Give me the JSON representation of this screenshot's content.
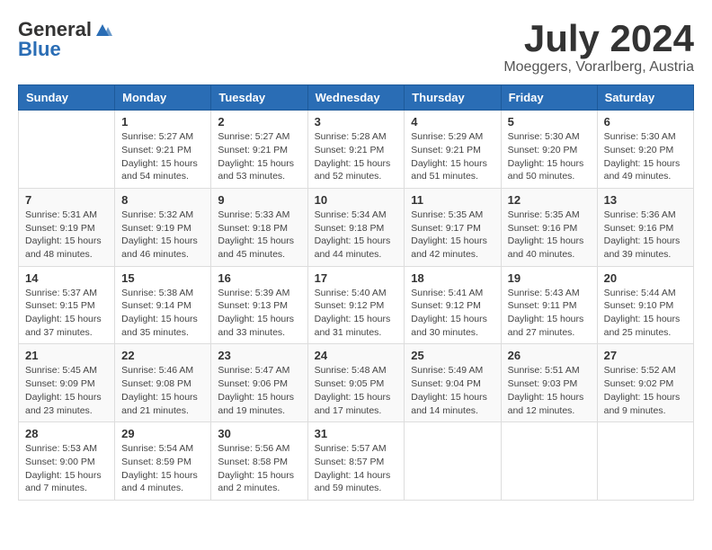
{
  "header": {
    "logo_general": "General",
    "logo_blue": "Blue",
    "month_year": "July 2024",
    "location": "Moeggers, Vorarlberg, Austria"
  },
  "weekdays": [
    "Sunday",
    "Monday",
    "Tuesday",
    "Wednesday",
    "Thursday",
    "Friday",
    "Saturday"
  ],
  "weeks": [
    [
      {
        "day": "",
        "info": ""
      },
      {
        "day": "1",
        "info": "Sunrise: 5:27 AM\nSunset: 9:21 PM\nDaylight: 15 hours\nand 54 minutes."
      },
      {
        "day": "2",
        "info": "Sunrise: 5:27 AM\nSunset: 9:21 PM\nDaylight: 15 hours\nand 53 minutes."
      },
      {
        "day": "3",
        "info": "Sunrise: 5:28 AM\nSunset: 9:21 PM\nDaylight: 15 hours\nand 52 minutes."
      },
      {
        "day": "4",
        "info": "Sunrise: 5:29 AM\nSunset: 9:21 PM\nDaylight: 15 hours\nand 51 minutes."
      },
      {
        "day": "5",
        "info": "Sunrise: 5:30 AM\nSunset: 9:20 PM\nDaylight: 15 hours\nand 50 minutes."
      },
      {
        "day": "6",
        "info": "Sunrise: 5:30 AM\nSunset: 9:20 PM\nDaylight: 15 hours\nand 49 minutes."
      }
    ],
    [
      {
        "day": "7",
        "info": "Sunrise: 5:31 AM\nSunset: 9:19 PM\nDaylight: 15 hours\nand 48 minutes."
      },
      {
        "day": "8",
        "info": "Sunrise: 5:32 AM\nSunset: 9:19 PM\nDaylight: 15 hours\nand 46 minutes."
      },
      {
        "day": "9",
        "info": "Sunrise: 5:33 AM\nSunset: 9:18 PM\nDaylight: 15 hours\nand 45 minutes."
      },
      {
        "day": "10",
        "info": "Sunrise: 5:34 AM\nSunset: 9:18 PM\nDaylight: 15 hours\nand 44 minutes."
      },
      {
        "day": "11",
        "info": "Sunrise: 5:35 AM\nSunset: 9:17 PM\nDaylight: 15 hours\nand 42 minutes."
      },
      {
        "day": "12",
        "info": "Sunrise: 5:35 AM\nSunset: 9:16 PM\nDaylight: 15 hours\nand 40 minutes."
      },
      {
        "day": "13",
        "info": "Sunrise: 5:36 AM\nSunset: 9:16 PM\nDaylight: 15 hours\nand 39 minutes."
      }
    ],
    [
      {
        "day": "14",
        "info": "Sunrise: 5:37 AM\nSunset: 9:15 PM\nDaylight: 15 hours\nand 37 minutes."
      },
      {
        "day": "15",
        "info": "Sunrise: 5:38 AM\nSunset: 9:14 PM\nDaylight: 15 hours\nand 35 minutes."
      },
      {
        "day": "16",
        "info": "Sunrise: 5:39 AM\nSunset: 9:13 PM\nDaylight: 15 hours\nand 33 minutes."
      },
      {
        "day": "17",
        "info": "Sunrise: 5:40 AM\nSunset: 9:12 PM\nDaylight: 15 hours\nand 31 minutes."
      },
      {
        "day": "18",
        "info": "Sunrise: 5:41 AM\nSunset: 9:12 PM\nDaylight: 15 hours\nand 30 minutes."
      },
      {
        "day": "19",
        "info": "Sunrise: 5:43 AM\nSunset: 9:11 PM\nDaylight: 15 hours\nand 27 minutes."
      },
      {
        "day": "20",
        "info": "Sunrise: 5:44 AM\nSunset: 9:10 PM\nDaylight: 15 hours\nand 25 minutes."
      }
    ],
    [
      {
        "day": "21",
        "info": "Sunrise: 5:45 AM\nSunset: 9:09 PM\nDaylight: 15 hours\nand 23 minutes."
      },
      {
        "day": "22",
        "info": "Sunrise: 5:46 AM\nSunset: 9:08 PM\nDaylight: 15 hours\nand 21 minutes."
      },
      {
        "day": "23",
        "info": "Sunrise: 5:47 AM\nSunset: 9:06 PM\nDaylight: 15 hours\nand 19 minutes."
      },
      {
        "day": "24",
        "info": "Sunrise: 5:48 AM\nSunset: 9:05 PM\nDaylight: 15 hours\nand 17 minutes."
      },
      {
        "day": "25",
        "info": "Sunrise: 5:49 AM\nSunset: 9:04 PM\nDaylight: 15 hours\nand 14 minutes."
      },
      {
        "day": "26",
        "info": "Sunrise: 5:51 AM\nSunset: 9:03 PM\nDaylight: 15 hours\nand 12 minutes."
      },
      {
        "day": "27",
        "info": "Sunrise: 5:52 AM\nSunset: 9:02 PM\nDaylight: 15 hours\nand 9 minutes."
      }
    ],
    [
      {
        "day": "28",
        "info": "Sunrise: 5:53 AM\nSunset: 9:00 PM\nDaylight: 15 hours\nand 7 minutes."
      },
      {
        "day": "29",
        "info": "Sunrise: 5:54 AM\nSunset: 8:59 PM\nDaylight: 15 hours\nand 4 minutes."
      },
      {
        "day": "30",
        "info": "Sunrise: 5:56 AM\nSunset: 8:58 PM\nDaylight: 15 hours\nand 2 minutes."
      },
      {
        "day": "31",
        "info": "Sunrise: 5:57 AM\nSunset: 8:57 PM\nDaylight: 14 hours\nand 59 minutes."
      },
      {
        "day": "",
        "info": ""
      },
      {
        "day": "",
        "info": ""
      },
      {
        "day": "",
        "info": ""
      }
    ]
  ]
}
